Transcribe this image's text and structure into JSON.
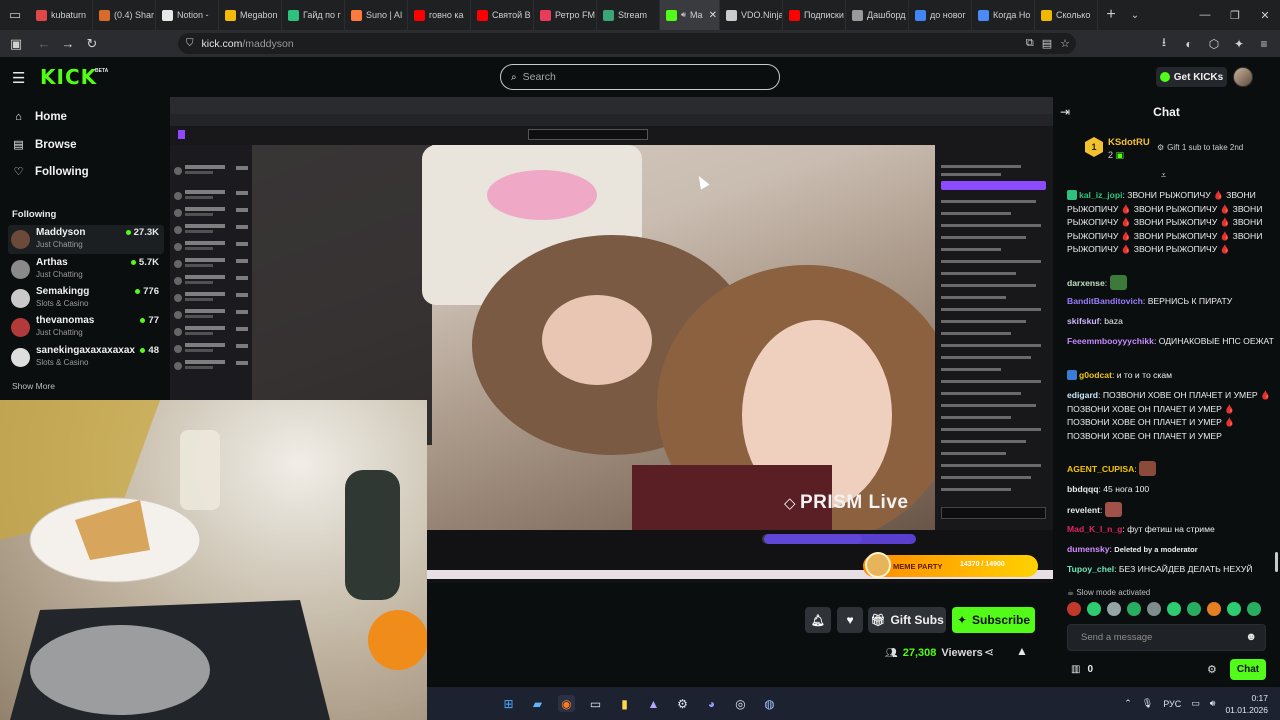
{
  "browser": {
    "tabs": [
      {
        "label": "kubaturn",
        "color": "#e04848"
      },
      {
        "label": "(0.4) Shar",
        "color": "#d86b2a"
      },
      {
        "label": "Notion - ",
        "color": "#e8e8e8"
      },
      {
        "label": "Megabon",
        "color": "#f5b90a"
      },
      {
        "label": "Гайд по г",
        "color": "#2ec27e"
      },
      {
        "label": "Suno | AI",
        "color": "#ff7a3d"
      },
      {
        "label": "говно ка",
        "color": "#ff0000"
      },
      {
        "label": "Святой В",
        "color": "#ff0000"
      },
      {
        "label": "Ретро FM",
        "color": "#e83c5a"
      },
      {
        "label": "Stream",
        "color": "#3aa675"
      },
      {
        "label": "Ma",
        "color": "#53fc18"
      },
      {
        "label": "VDO.Ninja",
        "color": "#cccccc"
      },
      {
        "label": "Подписки",
        "color": "#ff0000"
      },
      {
        "label": "Дашборд",
        "color": "#9a9a9a"
      },
      {
        "label": "до новог",
        "color": "#4285f4"
      },
      {
        "label": "Когда Но",
        "color": "#4c8bf5"
      },
      {
        "label": "Сколько",
        "color": "#f0b800"
      }
    ],
    "url_host": "kick.com",
    "url_path": "/maddyson"
  },
  "kick": {
    "logo": "KICK",
    "beta": "BETA",
    "search_placeholder": "Search",
    "get_kicks": "Get KICKs"
  },
  "sidebar": {
    "nav": [
      {
        "label": "Home",
        "icon": "home-icon"
      },
      {
        "label": "Browse",
        "icon": "browse-icon"
      },
      {
        "label": "Following",
        "icon": "heart-icon"
      }
    ],
    "following_heading": "Following",
    "channels": [
      {
        "name": "Maddyson",
        "category": "Just Chatting",
        "viewers": "27.3K",
        "avatar": "#6b4a3a"
      },
      {
        "name": "Arthas",
        "category": "Just Chatting",
        "viewers": "5.7K",
        "avatar": "#8a8a8a"
      },
      {
        "name": "Semakingg",
        "category": "Slots & Casino",
        "viewers": "776",
        "avatar": "#c9c9c9"
      },
      {
        "name": "thevanomas",
        "category": "Just Chatting",
        "viewers": "77",
        "avatar": "#b33a3a"
      },
      {
        "name": "sanekingaxaxaxaxax",
        "category": "Slots & Casino",
        "viewers": "48",
        "avatar": "#dedede"
      }
    ],
    "show_more": "Show More"
  },
  "stream_overlay": {
    "prism_text": "PRISM Live",
    "meme_label": "MEME PARTY",
    "meme_progress": "14370 / 14900"
  },
  "controls": {
    "gift_subs": "Gift Subs",
    "subscribe": "Subscribe",
    "viewer_count": "27,308",
    "viewer_label": "Viewers"
  },
  "chat": {
    "title": "Chat",
    "gifter_name": "KSdotRU",
    "gifter_count": "2",
    "gifter_rank": "1",
    "gift_cta": "Gift 1 sub to take 2nd",
    "messages": [
      {
        "user": "kal_iz_jopi",
        "color": "#2ec27e",
        "text": "ЗВОНИ РЫЖОПИЧУ 🩸 ЗВОНИ РЫЖОПИЧУ 🩸 ЗВОНИ РЫЖОПИЧУ 🩸 ЗВОНИ РЫЖОПИЧУ 🩸 ЗВОНИ РЫЖОПИЧУ 🩸 ЗВОНИ РЫЖОПИЧУ 🩸 ЗВОНИ РЫЖОПИЧУ 🩸 ЗВОНИ РЫЖОПИЧУ 🩸 ЗВОНИ РЫЖОПИЧУ 🩸"
      },
      {
        "user": "darxense",
        "color": "#c0e0c0",
        "text": ""
      },
      {
        "user": "BanditBanditovich",
        "color": "#9a7cff",
        "text": "ВЕРНИСЬ К ПИРАТУ"
      },
      {
        "user": "skifskuf",
        "color": "#d0b3ff",
        "text": "baza"
      },
      {
        "user": "Feeemmbooyyychikk",
        "color": "#c58bff",
        "text": "ОДИНАКОВЫЕ НПС ОЕЖАТ"
      },
      {
        "user": "g0odcat",
        "color": "#f0c419",
        "text": "и то и то скам"
      },
      {
        "user": "edigard",
        "color": "#c4e7ff",
        "text": "ПОЗВОНИ ХОВЕ ОН ПЛАЧЕТ И УМЕР 🩸 ПОЗВОНИ ХОВЕ ОН ПЛАЧЕТ И УМЕР 🩸 ПОЗВОНИ ХОВЕ ОН ПЛАЧЕТ И УМЕР 🩸 ПОЗВОНИ ХОВЕ ОН ПЛАЧЕТ И УМЕР"
      },
      {
        "user": "AGENT_CUPISA",
        "color": "#f5c400",
        "text": ""
      },
      {
        "user": "bbdqqq",
        "color": "#e8e8e8",
        "text": "45 нога 100"
      },
      {
        "user": "revelent",
        "color": "#e8e8e8",
        "text": ""
      },
      {
        "user": "Mad_K_I_n_g",
        "color": "#e0245e",
        "text": "фут фетиш на стриме"
      },
      {
        "user": "dumensky",
        "color": "#d48cff",
        "text": "Deleted by a moderator"
      },
      {
        "user": "Tupoy_chel",
        "color": "#6ee7b7",
        "text": "БЕЗ ИНСАЙДЕВ ДЕЛАТЬ НЕХУЙ"
      }
    ],
    "slow_mode": "Slow mode activated",
    "send_placeholder": "Send a message",
    "kicks_balance": "0",
    "send_button": "Chat"
  },
  "taskbar": {
    "lang": "РУС",
    "time": "0:17",
    "date": "01.01.2026"
  }
}
